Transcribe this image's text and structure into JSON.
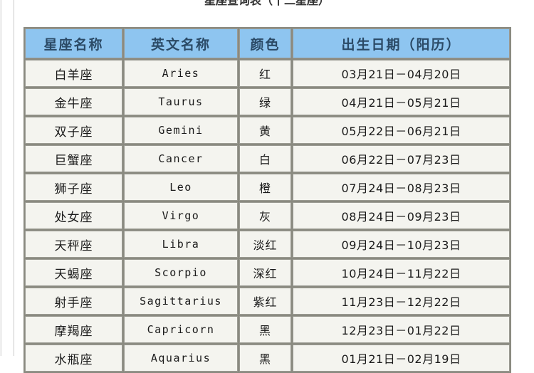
{
  "page": {
    "title_clipped": "星座查询表（十二星座）",
    "header_bg": "#8ec5f0",
    "cell_bg": "#f4f4ef",
    "border_color": "#9a9a92"
  },
  "table": {
    "columns": [
      {
        "key": "name",
        "label": "星座名称"
      },
      {
        "key": "en",
        "label": "英文名称"
      },
      {
        "key": "color",
        "label": "颜色"
      },
      {
        "key": "date",
        "label": "出生日期（阳历）"
      }
    ],
    "rows": [
      {
        "name": "白羊座",
        "en": "Aries",
        "color": "红",
        "date": "03月21日－04月20日"
      },
      {
        "name": "金牛座",
        "en": "Taurus",
        "color": "绿",
        "date": "04月21日－05月21日"
      },
      {
        "name": "双子座",
        "en": "Gemini",
        "color": "黄",
        "date": "05月22日－06月21日"
      },
      {
        "name": "巨蟹座",
        "en": "Cancer",
        "color": "白",
        "date": "06月22日－07月23日"
      },
      {
        "name": "狮子座",
        "en": "Leo",
        "color": "橙",
        "date": "07月24日－08月23日"
      },
      {
        "name": "处女座",
        "en": "Virgo",
        "color": "灰",
        "date": "08月24日－09月23日"
      },
      {
        "name": "天秤座",
        "en": "Libra",
        "color": "淡红",
        "date": "09月24日－10月23日"
      },
      {
        "name": "天蝎座",
        "en": "Scorpio",
        "color": "深红",
        "date": "10月24日－11月22日"
      },
      {
        "name": "射手座",
        "en": "Sagittarius",
        "color": "紫红",
        "date": "11月23日－12月22日"
      },
      {
        "name": "摩羯座",
        "en": "Capricorn",
        "color": "黑",
        "date": "12月23日－01月22日"
      },
      {
        "name": "水瓶座",
        "en": "Aquarius",
        "color": "黑",
        "date": "01月21日－02月19日"
      }
    ]
  }
}
